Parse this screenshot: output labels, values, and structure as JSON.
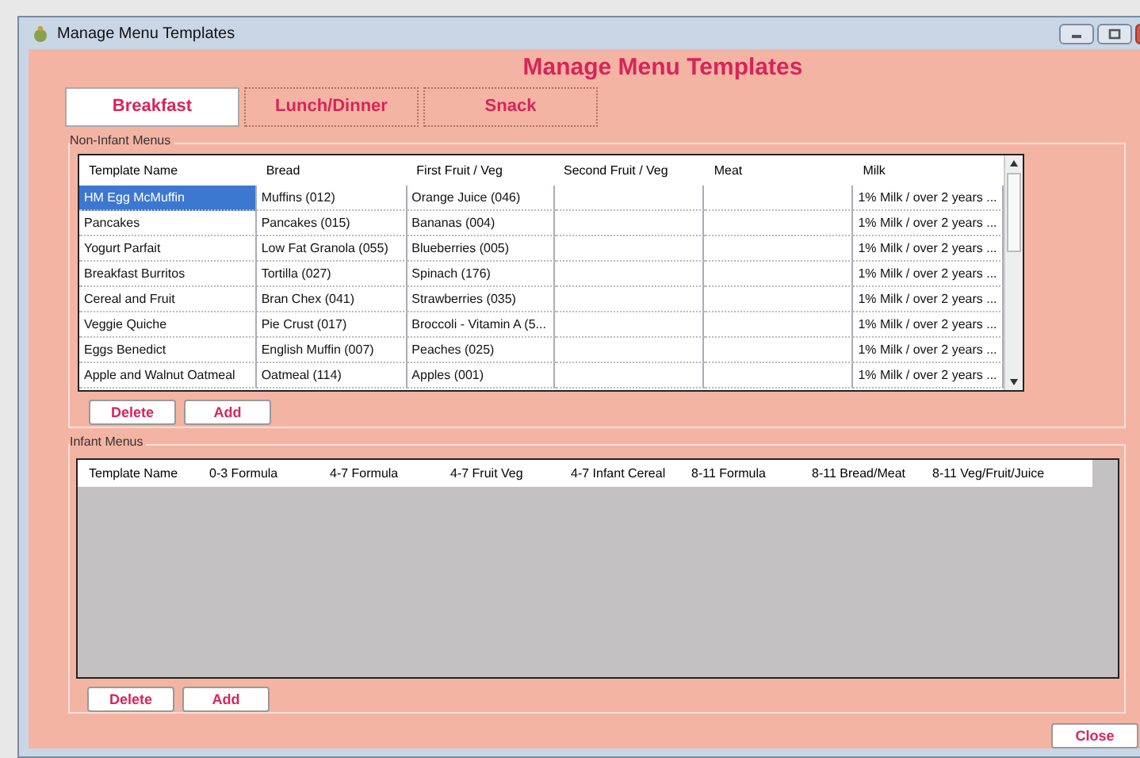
{
  "window": {
    "title": "Manage Menu Templates"
  },
  "heading": "Manage Menu Templates",
  "tabs": [
    {
      "label": "Breakfast",
      "selected": true
    },
    {
      "label": "Lunch/Dinner",
      "selected": false
    },
    {
      "label": "Snack",
      "selected": false
    }
  ],
  "non_infant_menus": {
    "label": "Non-Infant Menus",
    "columns": [
      "Template Name",
      "Bread",
      "First Fruit / Veg",
      "Second Fruit / Veg",
      "Meat",
      "Milk"
    ],
    "rows": [
      {
        "cells": [
          "HM Egg McMuffin",
          "Muffins (012)",
          "Orange Juice (046)",
          "",
          "",
          "1% Milk / over 2 years ..."
        ],
        "selected": true
      },
      {
        "cells": [
          "Pancakes",
          "Pancakes (015)",
          "Bananas (004)",
          "",
          "",
          "1% Milk / over 2 years ..."
        ],
        "selected": false
      },
      {
        "cells": [
          "Yogurt Parfait",
          "Low Fat Granola (055)",
          "Blueberries (005)",
          "",
          "",
          "1% Milk / over 2 years ..."
        ],
        "selected": false
      },
      {
        "cells": [
          "Breakfast Burritos",
          "Tortilla (027)",
          "Spinach (176)",
          "",
          "",
          "1% Milk / over 2 years ..."
        ],
        "selected": false
      },
      {
        "cells": [
          "Cereal and Fruit",
          "Bran Chex (041)",
          "Strawberries (035)",
          "",
          "",
          "1% Milk / over 2 years ..."
        ],
        "selected": false
      },
      {
        "cells": [
          "Veggie Quiche",
          "Pie Crust (017)",
          "Broccoli - Vitamin A (5...",
          "",
          "",
          "1% Milk / over 2 years ..."
        ],
        "selected": false
      },
      {
        "cells": [
          "Eggs Benedict",
          "English Muffin (007)",
          "Peaches (025)",
          "",
          "",
          "1% Milk / over 2 years ..."
        ],
        "selected": false
      },
      {
        "cells": [
          "Apple and Walnut Oatmeal",
          "Oatmeal (114)",
          "Apples (001)",
          "",
          "",
          "1% Milk / over 2 years ..."
        ],
        "selected": false
      }
    ],
    "buttons": [
      "Delete",
      "Add"
    ]
  },
  "infant_menus": {
    "label": "Infant Menus",
    "columns": [
      "Template Name",
      "0-3 Formula",
      "4-7 Formula",
      "4-7 Fruit Veg",
      "4-7 Infant Cereal",
      "8-11 Formula",
      "8-11 Bread/Meat",
      "8-11 Veg/Fruit/Juice"
    ],
    "buttons": [
      "Delete",
      "Add"
    ]
  },
  "close_button": "Close"
}
